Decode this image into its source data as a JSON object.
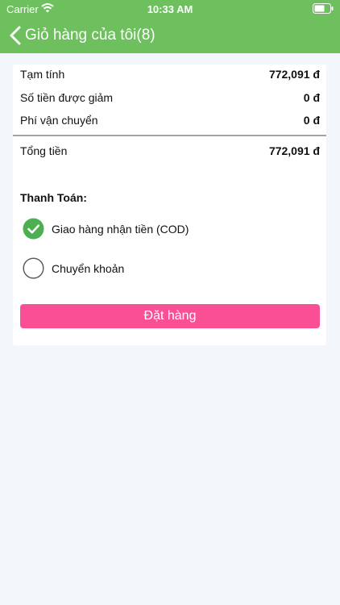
{
  "status_bar": {
    "carrier": "Carrier",
    "time": "10:33 AM"
  },
  "nav": {
    "title": "Giỏ hàng của tôi(8)"
  },
  "summary": {
    "subtotal_label": "Tạm tính",
    "subtotal_value": "772,091 đ",
    "discount_label": "Số tiền được giảm",
    "discount_value": "0 đ",
    "shipping_label": "Phí vận chuyển",
    "shipping_value": "0 đ",
    "total_label": "Tổng tiền",
    "total_value": "772,091 đ"
  },
  "payment": {
    "title": "Thanh Toán:",
    "options": [
      {
        "label": "Giao hàng nhận tiền (COD)",
        "selected": true
      },
      {
        "label": "Chuyển khoản",
        "selected": false
      }
    ]
  },
  "order_button": {
    "label": "Đặt hàng"
  },
  "colors": {
    "header": "#6ec05e",
    "selected": "#4caf50",
    "button": "#fa4f95"
  }
}
